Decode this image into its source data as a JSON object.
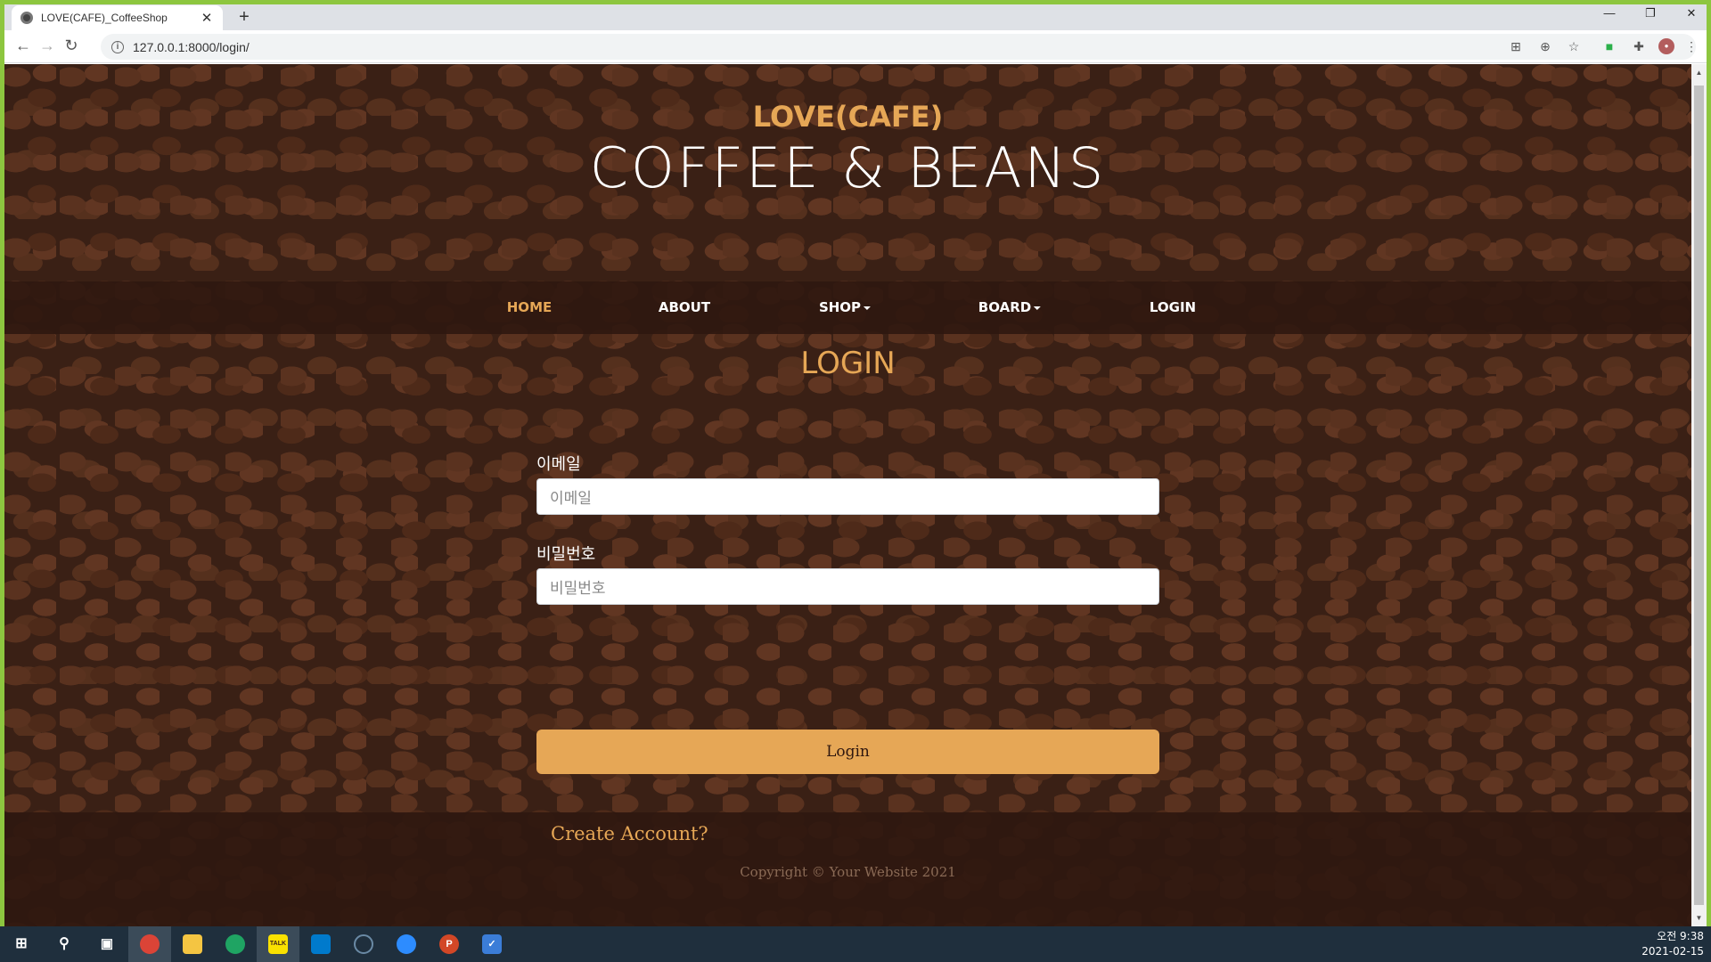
{
  "browser": {
    "tab_title": "LOVE(CAFE)_CoffeeShop",
    "tab_close": "✕",
    "new_tab": "+",
    "url": "127.0.0.1:8000/login/",
    "win_min": "—",
    "win_restore": "❐",
    "win_close": "✕"
  },
  "site": {
    "upper": "LOVE(CAFE)",
    "lower": "COFFEE & BEANS"
  },
  "nav": {
    "home": "HOME",
    "about": "ABOUT",
    "shop": "SHOP",
    "board": "BOARD",
    "login": "LOGIN"
  },
  "login": {
    "title": "LOGIN",
    "email_label": "이메일",
    "email_placeholder": "이메일",
    "password_label": "비밀번호",
    "password_placeholder": "비밀번호",
    "button": "Login",
    "create_account": "Create Account?"
  },
  "footer": {
    "copyright": "Copyright © Your Website 2021"
  },
  "taskbar": {
    "time": "오전 9:38",
    "date": "2021-02-15"
  },
  "colors": {
    "accent": "#e6a756",
    "nav_bg": "#2f170f",
    "desktop_border": "#8dc63f"
  }
}
